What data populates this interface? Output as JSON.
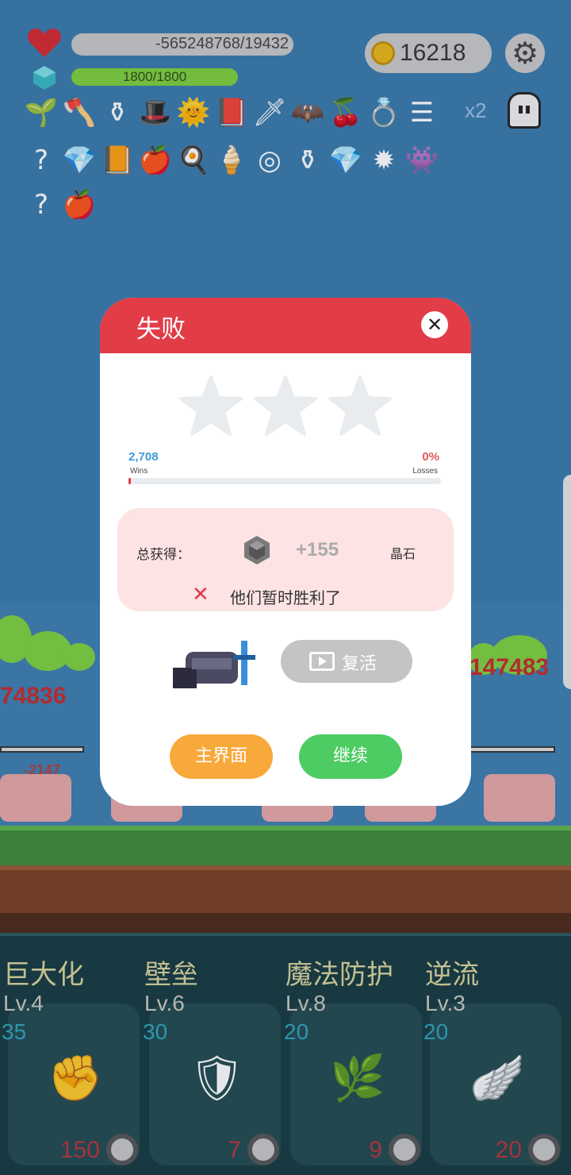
{
  "hud": {
    "hp_text": "-565248768/19432",
    "mp_text": "1800/1800",
    "coins": "16218",
    "speed_multiplier": "x2"
  },
  "inventory_icons": [
    "sapling-icon",
    "axe-icon",
    "cauldron-icon",
    "witch-hat-icon",
    "sun-orb-icon",
    "skull-book-icon",
    "dagger-icon",
    "bat-icon",
    "cherry-icon",
    "ring-icon",
    "scale-icon",
    "hook-icon",
    "diamond-icon",
    "spellbook-icon",
    "apple-icon",
    "egg-icon",
    "ice-cream-icon",
    "shield-disc-icon",
    "cauldron-icon",
    "diamond-icon",
    "spiked-mace-icon",
    "green-slime-icon",
    "hook-icon",
    "apple-icon"
  ],
  "dialog": {
    "title": "失败",
    "wins_value": "2,708",
    "wins_label": "Wins",
    "losses_value": "0%",
    "losses_label": "Losses",
    "stars_earned": 0,
    "reward_label": "总获得：",
    "reward_amount": "+155",
    "reward_unit": "晶石",
    "defeat_message": "他们暂时胜利了",
    "revive_label": "复活",
    "home_label": "主界面",
    "continue_label": "继续"
  },
  "skills": [
    {
      "name": "巨大化",
      "level": "Lv.4",
      "cost": "35",
      "price": "150",
      "icon": "fist-icon"
    },
    {
      "name": "壁垒",
      "level": "Lv.6",
      "cost": "30",
      "price": "7",
      "icon": "armor-icon"
    },
    {
      "name": "魔法防护",
      "level": "Lv.8",
      "cost": "20",
      "price": "9",
      "icon": "leaf-icon"
    },
    {
      "name": "逆流",
      "level": "Lv.3",
      "cost": "20",
      "price": "20",
      "icon": "wing-icon"
    }
  ],
  "colors": {
    "header_red": "#e23c47",
    "home_orange": "#f8a93b",
    "continue_green": "#4ccc62",
    "reward_bg": "#fde3e4"
  }
}
